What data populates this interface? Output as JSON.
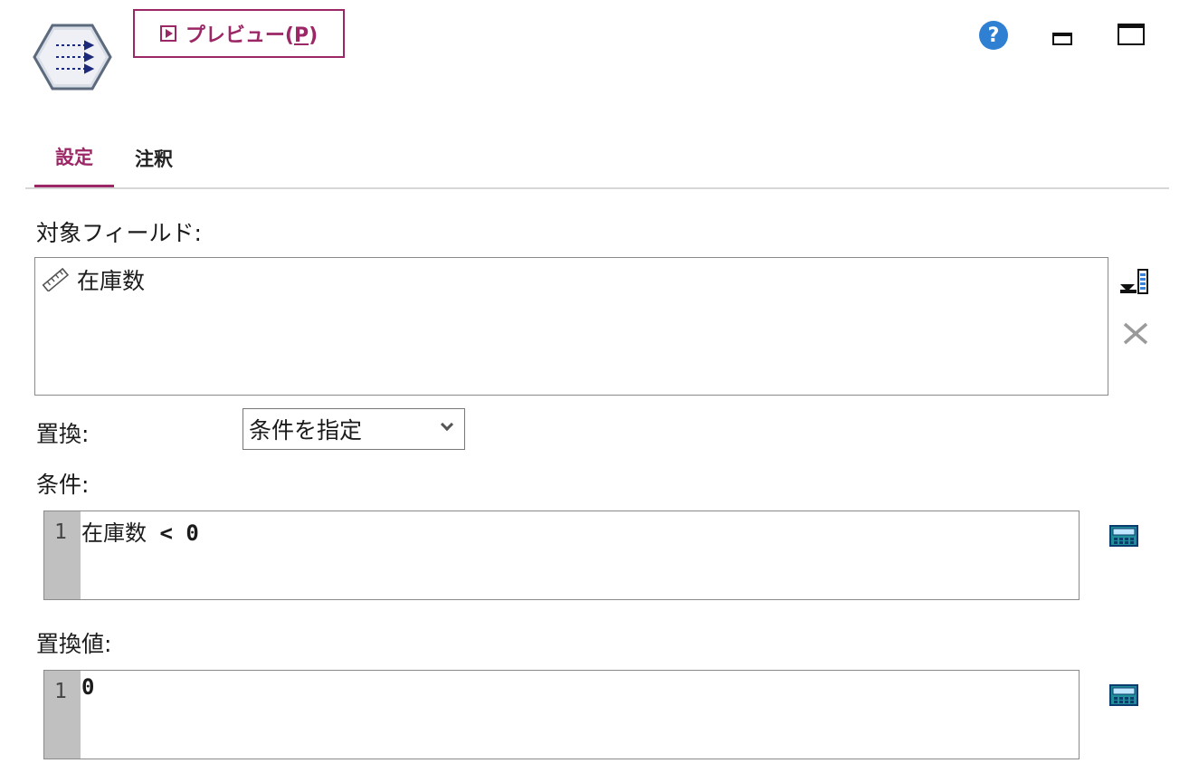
{
  "toolbar": {
    "preview_label": "プレビュー(",
    "preview_mnemonic": "P",
    "preview_suffix": ")",
    "help_symbol": "?"
  },
  "tabs": [
    {
      "label": "設定",
      "active": true
    },
    {
      "label": "注釈",
      "active": false
    }
  ],
  "target_fields": {
    "label": "対象フィールド:",
    "items": [
      "在庫数"
    ]
  },
  "replace": {
    "label": "置換:",
    "selected": "条件を指定"
  },
  "condition": {
    "label": "条件:",
    "line_number": "1",
    "field": "在庫数",
    "expression": " < 0"
  },
  "replace_value": {
    "label": "置換値:",
    "line_number": "1",
    "value": "0"
  },
  "colors": {
    "accent": "#9c2766",
    "help": "#2f7fd3",
    "gutter": "#c0c0c0"
  },
  "icons": {
    "node": "filler-node-icon",
    "field_type": "ruler-icon",
    "pick_field": "field-picker-icon",
    "remove": "close-icon",
    "calc": "expression-builder-icon"
  }
}
